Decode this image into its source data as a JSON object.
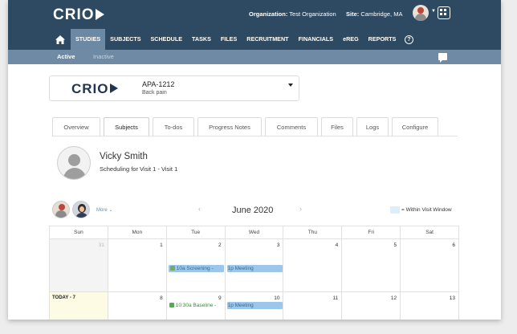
{
  "header": {
    "logo": "CRIO",
    "organization_label": "Organization:",
    "organization_value": "Test Organization",
    "site_label": "Site:",
    "site_value": "Cambridge, MA"
  },
  "nav": {
    "items": [
      "STUDIES",
      "SUBJECTS",
      "SCHEDULE",
      "TASKS",
      "FILES",
      "RECRUITMENT",
      "FINANCIALS",
      "eREG",
      "REPORTS"
    ],
    "active": "STUDIES"
  },
  "subnav": {
    "active_tab": "Active",
    "inactive_tab": "Inactive"
  },
  "study": {
    "logo": "CRIO",
    "code": "APA-1212",
    "description": "Back pain"
  },
  "tabs": [
    "Overview",
    "Subjects",
    "To-dos",
    "Progress Notes",
    "Comments",
    "Files",
    "Logs",
    "Configure"
  ],
  "active_tab": "Subjects",
  "subject": {
    "name": "Vicky Smith",
    "scheduling": "Scheduling for Visit 1 - Visit 1"
  },
  "calendar": {
    "more_label": "More",
    "prev": "‹",
    "next": "›",
    "title": "June 2020",
    "legend": "= Within Visit Window",
    "legend_color": "#dceefb",
    "days": [
      "Sun",
      "Mon",
      "Tue",
      "Wed",
      "Thu",
      "Fri",
      "Sat"
    ],
    "week1": [
      "31",
      "1",
      "2",
      "3",
      "4",
      "5",
      "6"
    ],
    "week2": [
      "7",
      "8",
      "9",
      "10",
      "11",
      "12",
      "13"
    ],
    "today_label": "TODAY - 7",
    "events": {
      "screening": "10a Screening -",
      "meeting1": "1p Meeting",
      "baseline": "10:30a Baseline -",
      "meeting2": "1p Meeting"
    }
  }
}
